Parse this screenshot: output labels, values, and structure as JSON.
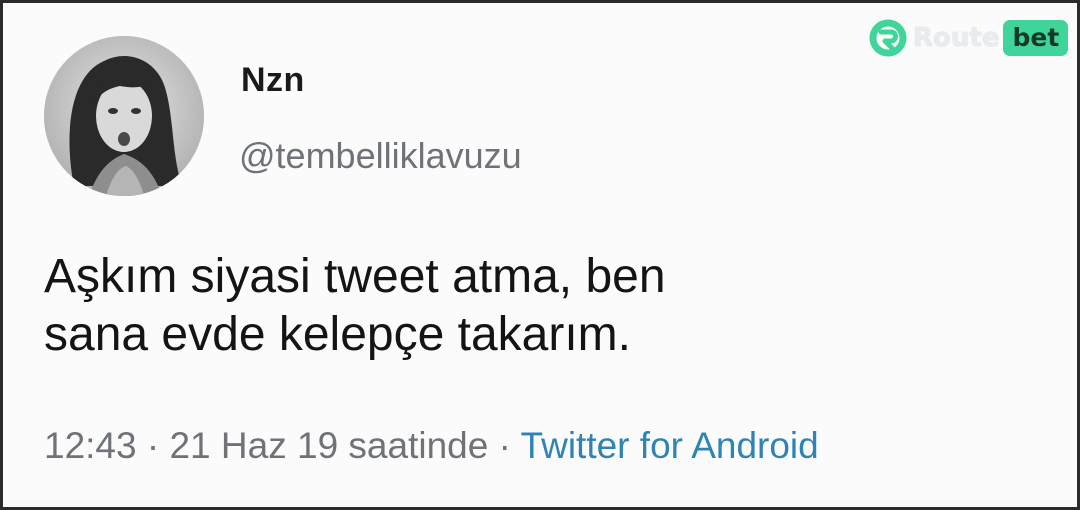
{
  "tweet": {
    "display_name": "Nzn",
    "handle": "@tembelliklavuzu",
    "text_lines": [
      "Aşkım siyasi tweet atma, ben",
      "sana evde kelepçe takarım."
    ],
    "time": "12:43",
    "date": "21 Haz 19 saatinde",
    "separator": "·",
    "source": "Twitter for Android"
  },
  "watermark": {
    "part1": "Route",
    "part2": "bet",
    "accent_color": "#3fd59a"
  },
  "colors": {
    "link": "#2f84b5",
    "secondary_text": "#6f7378",
    "primary_text": "#141414"
  }
}
